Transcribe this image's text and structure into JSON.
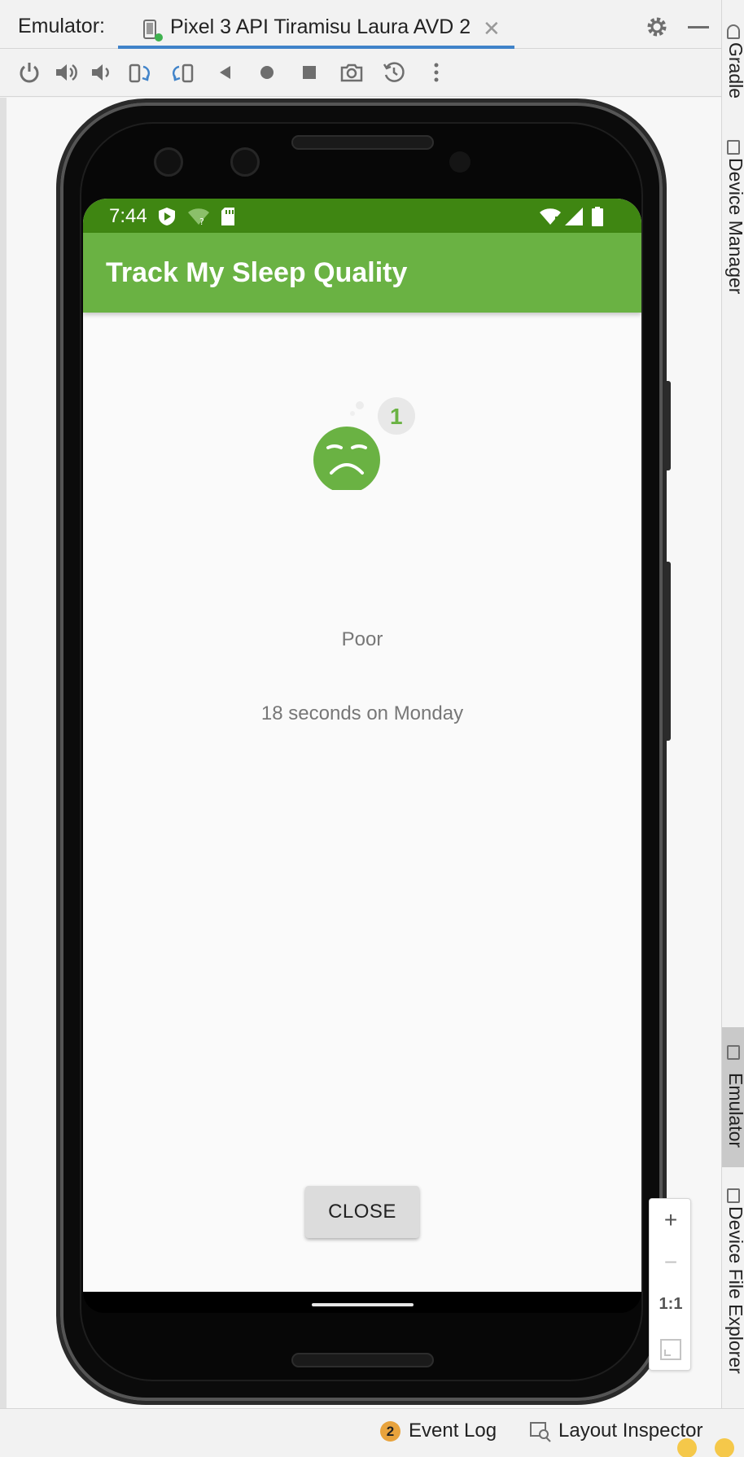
{
  "tool_window": {
    "label": "Emulator:",
    "tab_label": "Pixel 3 API Tiramisu Laura AVD 2",
    "tab_close": "✕"
  },
  "right_strip": {
    "gradle": "Gradle",
    "device_manager": "Device Manager",
    "emulator": "Emulator",
    "device_file_explorer": "Device File Explorer"
  },
  "device": {
    "status_time": "7:44",
    "app_title": "Track My Sleep Quality",
    "badge_number": "1",
    "quality_text": "Poor",
    "length_text": "18 seconds on Monday",
    "close_button": "CLOSE",
    "colors": {
      "status_bar": "#3f8612",
      "app_bar": "#6ab243",
      "face": "#6ab243"
    }
  },
  "zoom": {
    "zoom_in": "+",
    "zoom_out": "−",
    "actual_size": "1:1"
  },
  "bottom_bar": {
    "event_log_count": "2",
    "event_log": "Event Log",
    "layout_inspector": "Layout Inspector"
  },
  "icons": [
    "power-icon",
    "volume-up-icon",
    "volume-down-icon",
    "rotate-left-icon",
    "rotate-right-icon",
    "back-icon",
    "home-icon",
    "overview-icon",
    "screenshot-icon",
    "snapshot-icon",
    "more-icon",
    "gear-icon",
    "minimize-icon"
  ]
}
